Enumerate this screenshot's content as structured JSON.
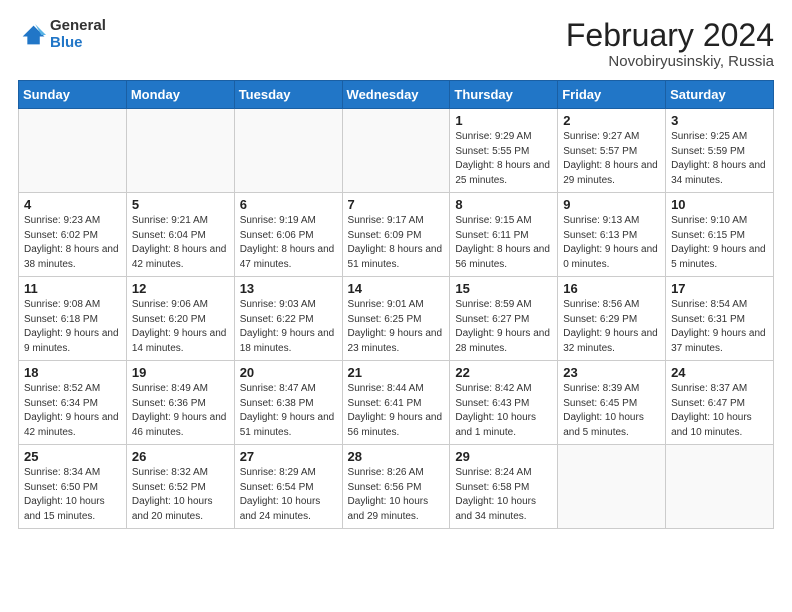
{
  "logo": {
    "general": "General",
    "blue": "Blue"
  },
  "title": "February 2024",
  "subtitle": "Novobiryusinskiy, Russia",
  "weekdays": [
    "Sunday",
    "Monday",
    "Tuesday",
    "Wednesday",
    "Thursday",
    "Friday",
    "Saturday"
  ],
  "weeks": [
    [
      null,
      null,
      null,
      null,
      {
        "day": "1",
        "sunrise": "Sunrise: 9:29 AM",
        "sunset": "Sunset: 5:55 PM",
        "daylight": "Daylight: 8 hours and 25 minutes."
      },
      {
        "day": "2",
        "sunrise": "Sunrise: 9:27 AM",
        "sunset": "Sunset: 5:57 PM",
        "daylight": "Daylight: 8 hours and 29 minutes."
      },
      {
        "day": "3",
        "sunrise": "Sunrise: 9:25 AM",
        "sunset": "Sunset: 5:59 PM",
        "daylight": "Daylight: 8 hours and 34 minutes."
      }
    ],
    [
      {
        "day": "4",
        "sunrise": "Sunrise: 9:23 AM",
        "sunset": "Sunset: 6:02 PM",
        "daylight": "Daylight: 8 hours and 38 minutes."
      },
      {
        "day": "5",
        "sunrise": "Sunrise: 9:21 AM",
        "sunset": "Sunset: 6:04 PM",
        "daylight": "Daylight: 8 hours and 42 minutes."
      },
      {
        "day": "6",
        "sunrise": "Sunrise: 9:19 AM",
        "sunset": "Sunset: 6:06 PM",
        "daylight": "Daylight: 8 hours and 47 minutes."
      },
      {
        "day": "7",
        "sunrise": "Sunrise: 9:17 AM",
        "sunset": "Sunset: 6:09 PM",
        "daylight": "Daylight: 8 hours and 51 minutes."
      },
      {
        "day": "8",
        "sunrise": "Sunrise: 9:15 AM",
        "sunset": "Sunset: 6:11 PM",
        "daylight": "Daylight: 8 hours and 56 minutes."
      },
      {
        "day": "9",
        "sunrise": "Sunrise: 9:13 AM",
        "sunset": "Sunset: 6:13 PM",
        "daylight": "Daylight: 9 hours and 0 minutes."
      },
      {
        "day": "10",
        "sunrise": "Sunrise: 9:10 AM",
        "sunset": "Sunset: 6:15 PM",
        "daylight": "Daylight: 9 hours and 5 minutes."
      }
    ],
    [
      {
        "day": "11",
        "sunrise": "Sunrise: 9:08 AM",
        "sunset": "Sunset: 6:18 PM",
        "daylight": "Daylight: 9 hours and 9 minutes."
      },
      {
        "day": "12",
        "sunrise": "Sunrise: 9:06 AM",
        "sunset": "Sunset: 6:20 PM",
        "daylight": "Daylight: 9 hours and 14 minutes."
      },
      {
        "day": "13",
        "sunrise": "Sunrise: 9:03 AM",
        "sunset": "Sunset: 6:22 PM",
        "daylight": "Daylight: 9 hours and 18 minutes."
      },
      {
        "day": "14",
        "sunrise": "Sunrise: 9:01 AM",
        "sunset": "Sunset: 6:25 PM",
        "daylight": "Daylight: 9 hours and 23 minutes."
      },
      {
        "day": "15",
        "sunrise": "Sunrise: 8:59 AM",
        "sunset": "Sunset: 6:27 PM",
        "daylight": "Daylight: 9 hours and 28 minutes."
      },
      {
        "day": "16",
        "sunrise": "Sunrise: 8:56 AM",
        "sunset": "Sunset: 6:29 PM",
        "daylight": "Daylight: 9 hours and 32 minutes."
      },
      {
        "day": "17",
        "sunrise": "Sunrise: 8:54 AM",
        "sunset": "Sunset: 6:31 PM",
        "daylight": "Daylight: 9 hours and 37 minutes."
      }
    ],
    [
      {
        "day": "18",
        "sunrise": "Sunrise: 8:52 AM",
        "sunset": "Sunset: 6:34 PM",
        "daylight": "Daylight: 9 hours and 42 minutes."
      },
      {
        "day": "19",
        "sunrise": "Sunrise: 8:49 AM",
        "sunset": "Sunset: 6:36 PM",
        "daylight": "Daylight: 9 hours and 46 minutes."
      },
      {
        "day": "20",
        "sunrise": "Sunrise: 8:47 AM",
        "sunset": "Sunset: 6:38 PM",
        "daylight": "Daylight: 9 hours and 51 minutes."
      },
      {
        "day": "21",
        "sunrise": "Sunrise: 8:44 AM",
        "sunset": "Sunset: 6:41 PM",
        "daylight": "Daylight: 9 hours and 56 minutes."
      },
      {
        "day": "22",
        "sunrise": "Sunrise: 8:42 AM",
        "sunset": "Sunset: 6:43 PM",
        "daylight": "Daylight: 10 hours and 1 minute."
      },
      {
        "day": "23",
        "sunrise": "Sunrise: 8:39 AM",
        "sunset": "Sunset: 6:45 PM",
        "daylight": "Daylight: 10 hours and 5 minutes."
      },
      {
        "day": "24",
        "sunrise": "Sunrise: 8:37 AM",
        "sunset": "Sunset: 6:47 PM",
        "daylight": "Daylight: 10 hours and 10 minutes."
      }
    ],
    [
      {
        "day": "25",
        "sunrise": "Sunrise: 8:34 AM",
        "sunset": "Sunset: 6:50 PM",
        "daylight": "Daylight: 10 hours and 15 minutes."
      },
      {
        "day": "26",
        "sunrise": "Sunrise: 8:32 AM",
        "sunset": "Sunset: 6:52 PM",
        "daylight": "Daylight: 10 hours and 20 minutes."
      },
      {
        "day": "27",
        "sunrise": "Sunrise: 8:29 AM",
        "sunset": "Sunset: 6:54 PM",
        "daylight": "Daylight: 10 hours and 24 minutes."
      },
      {
        "day": "28",
        "sunrise": "Sunrise: 8:26 AM",
        "sunset": "Sunset: 6:56 PM",
        "daylight": "Daylight: 10 hours and 29 minutes."
      },
      {
        "day": "29",
        "sunrise": "Sunrise: 8:24 AM",
        "sunset": "Sunset: 6:58 PM",
        "daylight": "Daylight: 10 hours and 34 minutes."
      },
      null,
      null
    ]
  ]
}
